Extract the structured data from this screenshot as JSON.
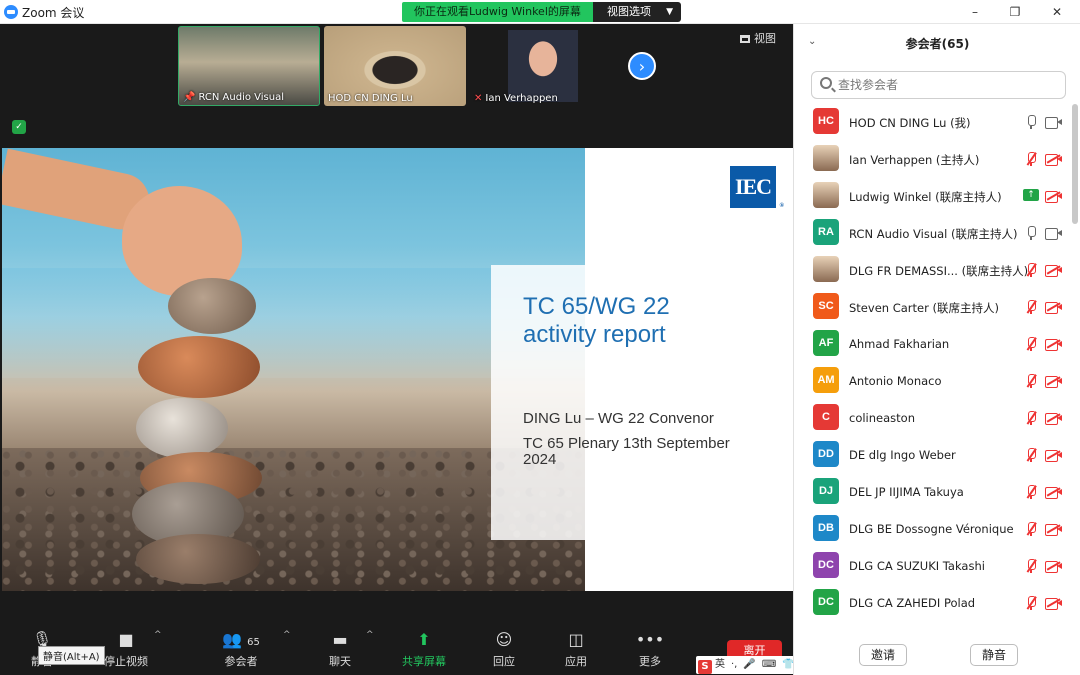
{
  "titlebar": {
    "app_title": "Zoom 会议",
    "viewing_banner": "你正在观看Ludwig Winkel的屏幕",
    "view_options": "视图选项",
    "minimize": "–",
    "restore": "❐",
    "close": "✕"
  },
  "thumbnails": [
    {
      "name": "RCN Audio Visual",
      "icon": "pin-icon"
    },
    {
      "name": "HOD CN DING Lu",
      "icon": ""
    },
    {
      "name": "Ian Verhappen",
      "icon": "mic-muted-icon"
    }
  ],
  "view_button": "视图",
  "slide": {
    "logo": "IEC",
    "title_line1": "TC 65/WG 22",
    "title_line2": "activity report",
    "line1": "DING Lu – WG 22 Convenor",
    "line2": "TC 65 Plenary 13th September",
    "line3": "2024"
  },
  "toolbar": {
    "mute": "静音",
    "mute_tooltip": "静音(Alt+A)",
    "stop_video": "停止视频",
    "participants": "参会者",
    "participants_count": "65",
    "chat": "聊天",
    "share_screen": "共享屏幕",
    "reactions": "回应",
    "apps": "应用",
    "more": "更多",
    "leave": "离开",
    "ime_label": "英"
  },
  "panel": {
    "title": "参会者(65)",
    "search_placeholder": "查找参会者",
    "invite": "邀请",
    "mute_all": "静音",
    "participants": [
      {
        "initials": "HC",
        "color": "#e53935",
        "name": "HOD CN DING Lu (我)",
        "mic": "on",
        "cam": "on",
        "avatar": "initials"
      },
      {
        "initials": "",
        "color": "#7a6a5a",
        "name": "Ian Verhappen (主持人)",
        "mic": "muted",
        "cam": "off",
        "avatar": "photo"
      },
      {
        "initials": "",
        "color": "#9a8a7a",
        "name": "Ludwig Winkel (联席主持人)",
        "mic": "share",
        "cam": "off",
        "avatar": "photo"
      },
      {
        "initials": "RA",
        "color": "#1aa37a",
        "name": "RCN Audio Visual (联席主持人)",
        "mic": "on",
        "cam": "on",
        "avatar": "initials"
      },
      {
        "initials": "",
        "color": "#b89a80",
        "name": "DLG FR DEMASSI... (联席主持人)",
        "mic": "muted",
        "cam": "off",
        "avatar": "photo"
      },
      {
        "initials": "SC",
        "color": "#f05a1a",
        "name": "Steven Carter (联席主持人)",
        "mic": "muted",
        "cam": "off",
        "avatar": "initials"
      },
      {
        "initials": "AF",
        "color": "#22a447",
        "name": "Ahmad Fakharian",
        "mic": "muted",
        "cam": "off",
        "avatar": "initials"
      },
      {
        "initials": "AM",
        "color": "#f59e0b",
        "name": "Antonio Monaco",
        "mic": "muted",
        "cam": "off",
        "avatar": "initials"
      },
      {
        "initials": "C",
        "color": "#e53935",
        "name": "colineaston",
        "mic": "muted",
        "cam": "off",
        "avatar": "initials"
      },
      {
        "initials": "DD",
        "color": "#1e88c8",
        "name": "DE dlg Ingo Weber",
        "mic": "muted",
        "cam": "off",
        "avatar": "initials"
      },
      {
        "initials": "DJ",
        "color": "#1aa37a",
        "name": "DEL JP IIJIMA Takuya",
        "mic": "muted",
        "cam": "off",
        "avatar": "initials"
      },
      {
        "initials": "DB",
        "color": "#1e88c8",
        "name": "DLG BE Dossogne Véronique",
        "mic": "muted",
        "cam": "off",
        "avatar": "initials"
      },
      {
        "initials": "DC",
        "color": "#8e44ad",
        "name": "DLG CA SUZUKI Takashi",
        "mic": "muted",
        "cam": "off",
        "avatar": "initials"
      },
      {
        "initials": "DC",
        "color": "#22a447",
        "name": "DLG CA ZAHEDI Polad",
        "mic": "muted",
        "cam": "off",
        "avatar": "initials"
      }
    ]
  }
}
